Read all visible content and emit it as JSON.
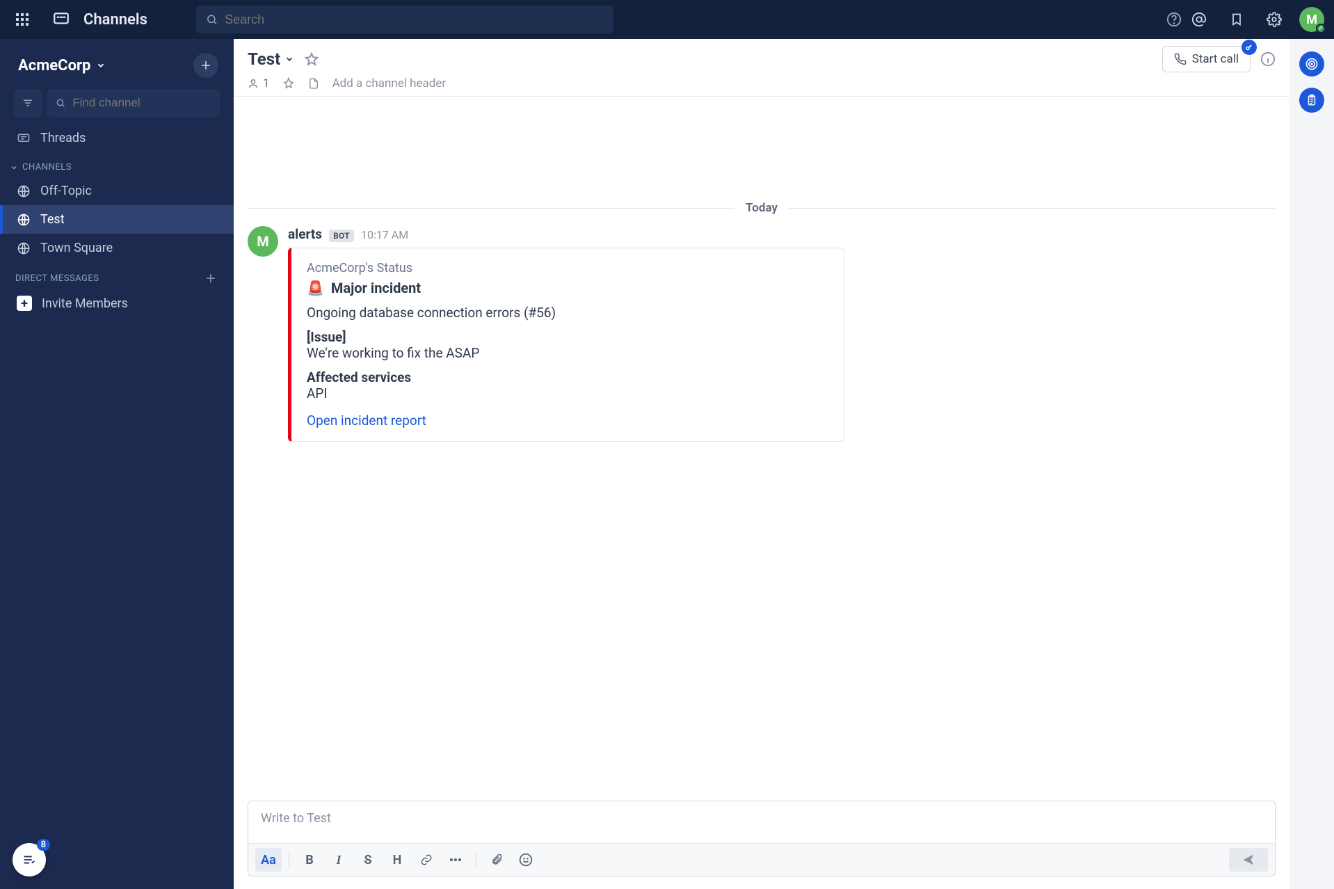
{
  "topbar": {
    "title": "Channels",
    "search_placeholder": "Search",
    "avatar_initial": "M"
  },
  "sidebar": {
    "team_name": "AcmeCorp",
    "find_placeholder": "Find channel",
    "threads_label": "Threads",
    "channels_header": "CHANNELS",
    "dm_header": "DIRECT MESSAGES",
    "invite_label": "Invite Members",
    "draft_badge": "8",
    "channels": [
      {
        "label": "Off-Topic",
        "active": false
      },
      {
        "label": "Test",
        "active": true
      },
      {
        "label": "Town Square",
        "active": false
      }
    ]
  },
  "channel": {
    "name": "Test",
    "member_count": "1",
    "header_placeholder": "Add a channel header",
    "start_call": "Start call"
  },
  "divider_label": "Today",
  "post": {
    "avatar_initial": "M",
    "username": "alerts",
    "bot_tag": "BOT",
    "time": "10:17 AM",
    "attachment": {
      "source": "AcmeCorp's Status",
      "title": "Major incident",
      "summary": "Ongoing database connection errors (#56)",
      "issue_label": "[Issue]",
      "issue_text": "We're working to fix the ASAP",
      "affected_label": "Affected services",
      "affected_value": "API",
      "link_text": "Open incident report"
    }
  },
  "composer": {
    "placeholder": "Write to Test",
    "aa": "Aa",
    "bold": "B",
    "italic": "I",
    "strike": "S",
    "heading": "H"
  }
}
